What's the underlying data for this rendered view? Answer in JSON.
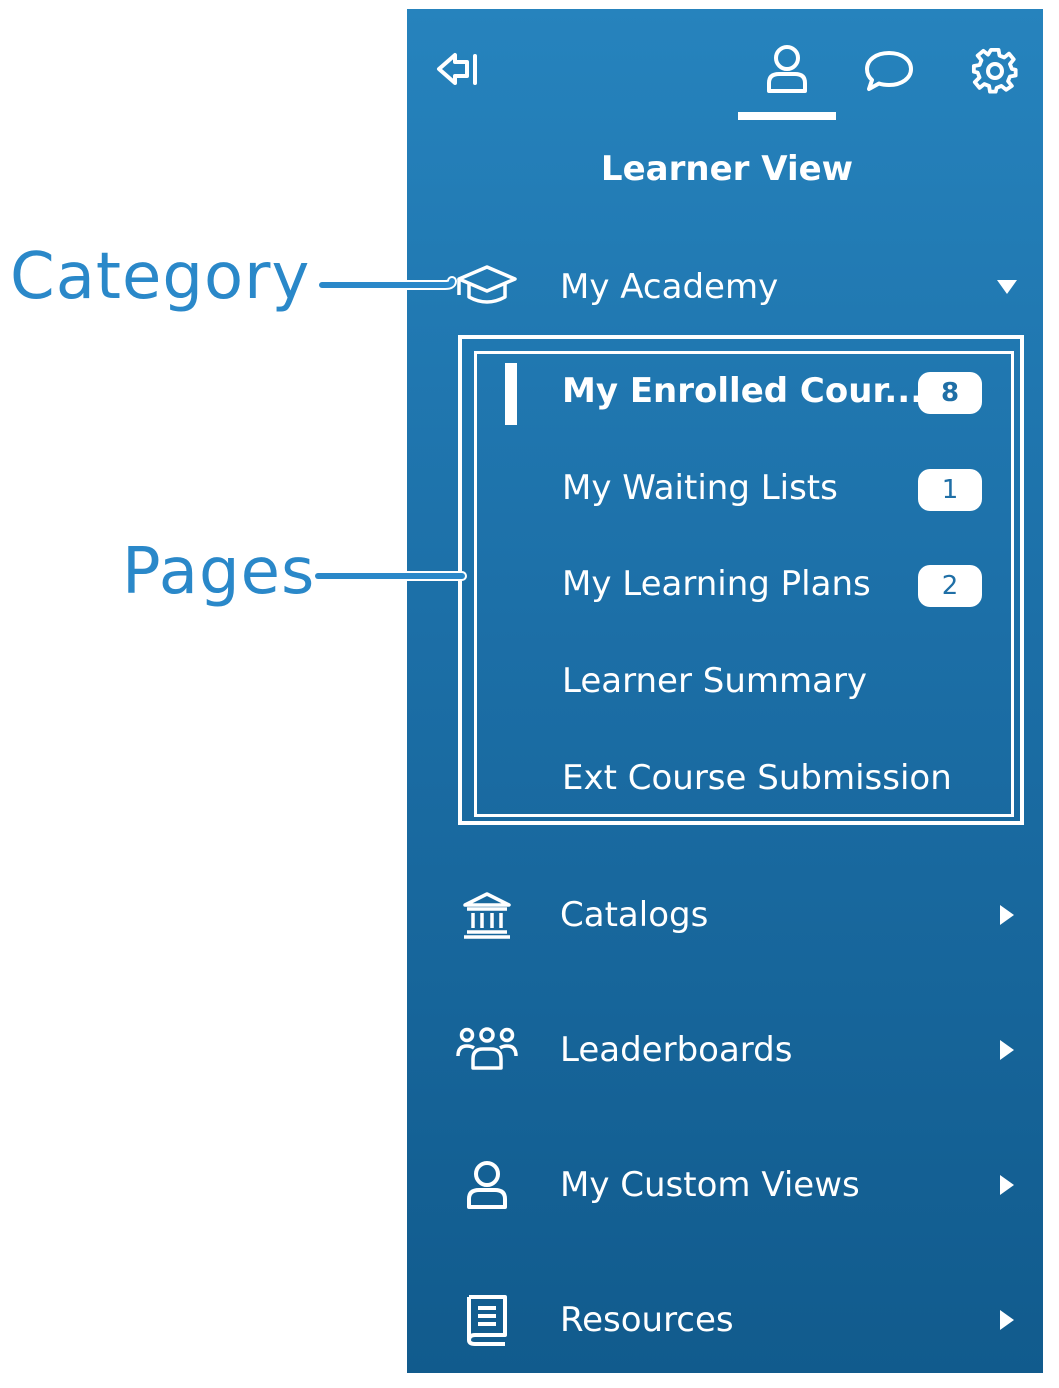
{
  "annotations": {
    "category_label": "Category",
    "pages_label": "Pages"
  },
  "sidebar": {
    "view_title": "Learner View",
    "tabs": [
      {
        "name": "user-tab",
        "icon": "user-icon",
        "active": true
      },
      {
        "name": "chat-tab",
        "icon": "chat-bubble-icon",
        "active": false
      },
      {
        "name": "settings-tab",
        "icon": "gear-icon",
        "active": false
      }
    ],
    "collapse_icon": "collapse-left-icon",
    "categories": [
      {
        "label": "My Academy",
        "icon": "graduation-cap-icon",
        "expanded": true,
        "pages": [
          {
            "label": "My Enrolled Cour...",
            "badge": "8",
            "active": true
          },
          {
            "label": "My Waiting Lists",
            "badge": "1",
            "active": false
          },
          {
            "label": "My Learning Plans",
            "badge": "2",
            "active": false
          },
          {
            "label": "Learner Summary",
            "badge": null,
            "active": false
          },
          {
            "label": "Ext Course Submission",
            "badge": null,
            "active": false
          }
        ]
      },
      {
        "label": "Catalogs",
        "icon": "museum-icon",
        "expanded": false
      },
      {
        "label": "Leaderboards",
        "icon": "group-icon",
        "expanded": false
      },
      {
        "label": "My Custom Views",
        "icon": "user-icon",
        "expanded": false
      },
      {
        "label": "Resources",
        "icon": "book-icon",
        "expanded": false
      }
    ]
  },
  "colors": {
    "accent": "#2a88c9",
    "sidebar_top": "#2683bd",
    "sidebar_bottom": "#115b8d",
    "badge_text": "#1f6fa6"
  }
}
